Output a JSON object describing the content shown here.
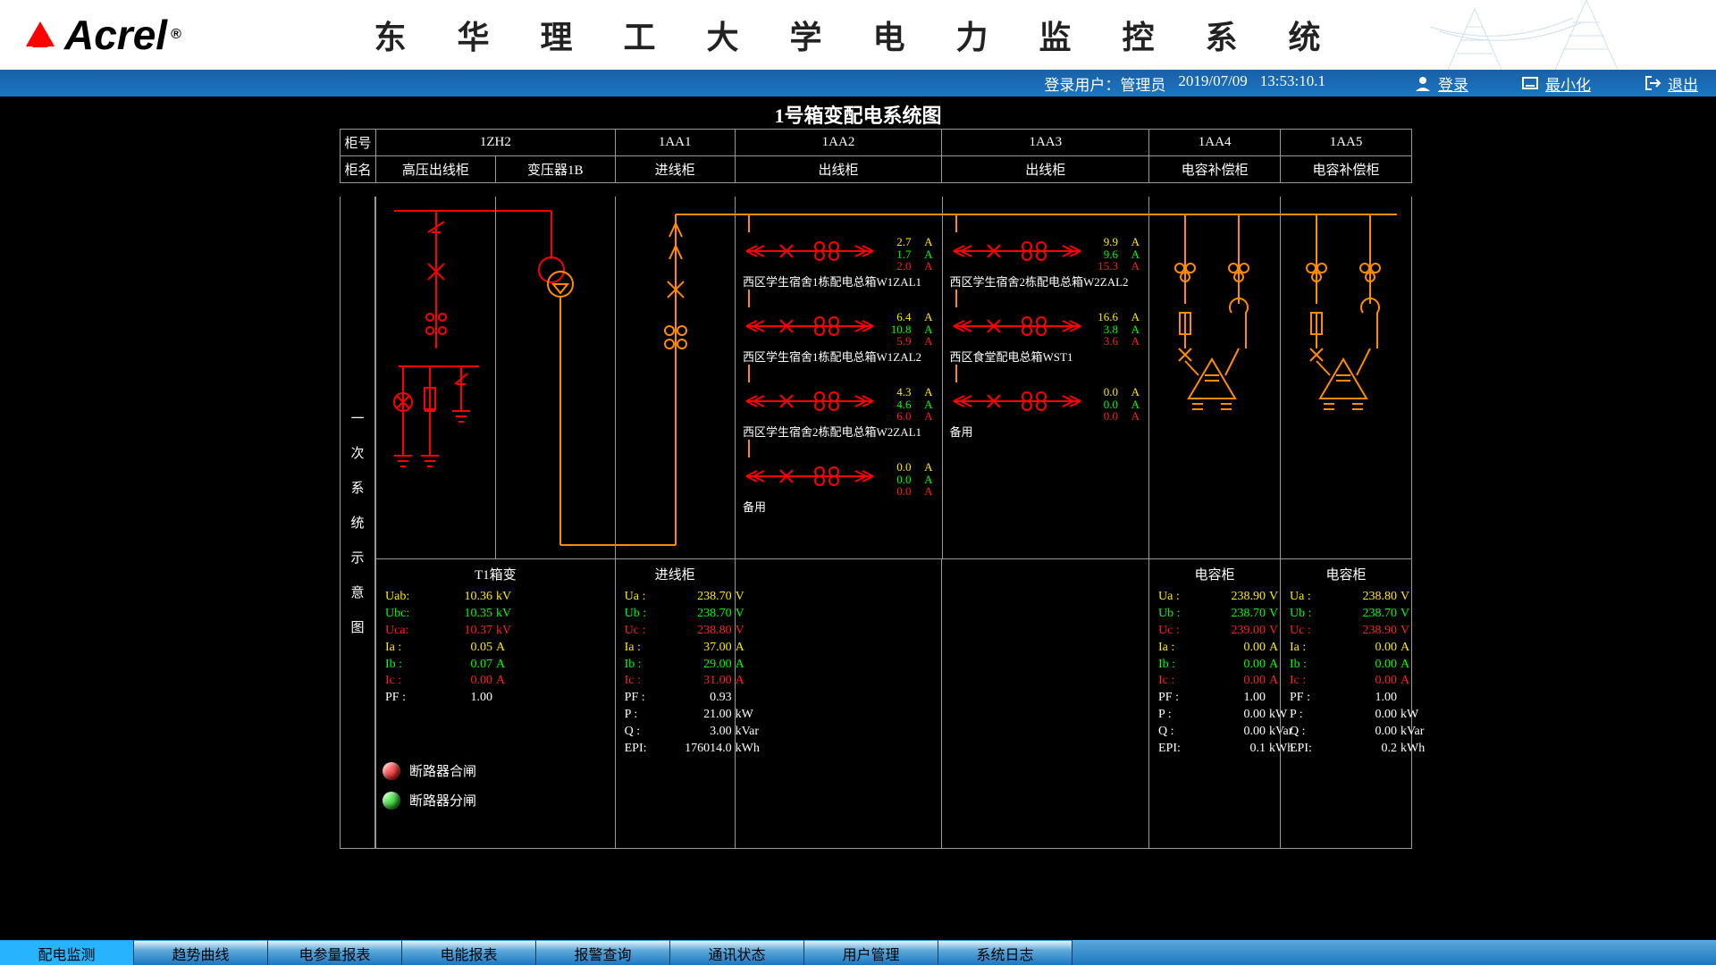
{
  "header": {
    "brand": "Acrel",
    "registered": "®",
    "system_title": "东 华 理 工 大 学 电 力 监 控 系 统"
  },
  "subheader": {
    "user_label": "登录用户：",
    "user": "管理员",
    "date": "2019/07/09",
    "time": "13:53:10.1",
    "login": "登录",
    "minimize": "最小化",
    "exit": "退出"
  },
  "page_title": "1号箱变配电系统图",
  "table": {
    "row1_label": "柜号",
    "row2_label": "柜名",
    "row3_label": "一次系统示意图",
    "cols": [
      {
        "no": "1ZH2",
        "name": "高压出线柜"
      },
      {
        "no": "",
        "name": "变压器1B"
      },
      {
        "no": "1AA1",
        "name": "进线柜"
      },
      {
        "no": "1AA2",
        "name": "出线柜"
      },
      {
        "no": "1AA3",
        "name": "出线柜"
      },
      {
        "no": "1AA4",
        "name": "电容补偿柜"
      },
      {
        "no": "1AA5",
        "name": "电容补偿柜"
      }
    ]
  },
  "feeders_1aa2": [
    {
      "a": "2.7",
      "b": "1.7",
      "c": "2.0",
      "label": "西区学生宿舍1栋配电总箱W1ZAL1"
    },
    {
      "a": "6.4",
      "b": "10.8",
      "c": "5.9",
      "label": "西区学生宿舍1栋配电总箱W1ZAL2"
    },
    {
      "a": "4.3",
      "b": "4.6",
      "c": "6.0",
      "label": "西区学生宿舍2栋配电总箱W2ZAL1"
    },
    {
      "a": "0.0",
      "b": "0.0",
      "c": "0.0",
      "label": "备用"
    }
  ],
  "feeders_1aa3": [
    {
      "a": "9.9",
      "b": "9.6",
      "c": "15.3",
      "label": "西区学生宿舍2栋配电总箱W2ZAL2"
    },
    {
      "a": "16.6",
      "b": "3.8",
      "c": "3.6",
      "label": "西区食堂配电总箱WST1"
    },
    {
      "a": "0.0",
      "b": "0.0",
      "c": "0.0",
      "label": "备用"
    }
  ],
  "data": {
    "t1": {
      "title": "T1箱变",
      "rows": [
        [
          "Uab:",
          "10.36",
          "kV",
          "y"
        ],
        [
          "Ubc:",
          "10.35",
          "kV",
          "g"
        ],
        [
          "Uca:",
          "10.37",
          "kV",
          "r"
        ],
        [
          "Ia :",
          "0.05",
          "A",
          "y"
        ],
        [
          "Ib :",
          "0.07",
          "A",
          "g"
        ],
        [
          "Ic :",
          "0.00",
          "A",
          "r"
        ],
        [
          "PF :",
          "1.00",
          "",
          "w"
        ]
      ]
    },
    "incoming": {
      "title": "进线柜",
      "rows": [
        [
          "Ua :",
          "238.70",
          "V",
          "y"
        ],
        [
          "Ub :",
          "238.70",
          "V",
          "g"
        ],
        [
          "Uc :",
          "238.80",
          "V",
          "r"
        ],
        [
          "Ia :",
          "37.00",
          "A",
          "y"
        ],
        [
          "Ib :",
          "29.00",
          "A",
          "g"
        ],
        [
          "Ic :",
          "31.00",
          "A",
          "r"
        ],
        [
          "PF :",
          "0.93",
          "",
          "w"
        ],
        [
          "P  :",
          "21.00",
          "kW",
          "w"
        ],
        [
          "Q  :",
          "3.00",
          "kVar",
          "w"
        ],
        [
          "EPI:",
          "176014.0",
          "kWh",
          "w"
        ]
      ]
    },
    "cap1": {
      "title": "电容柜",
      "rows": [
        [
          "Ua :",
          "238.90",
          "V",
          "y"
        ],
        [
          "Ub :",
          "238.70",
          "V",
          "g"
        ],
        [
          "Uc :",
          "239.00",
          "V",
          "r"
        ],
        [
          "Ia :",
          "0.00",
          "A",
          "y"
        ],
        [
          "Ib :",
          "0.00",
          "A",
          "g"
        ],
        [
          "Ic :",
          "0.00",
          "A",
          "r"
        ],
        [
          "PF :",
          "1.00",
          "",
          "w"
        ],
        [
          "P  :",
          "0.00",
          "kW",
          "w"
        ],
        [
          "Q  :",
          "0.00",
          "kVar",
          "w"
        ],
        [
          "EPI:",
          "0.1",
          "kWh",
          "w"
        ]
      ]
    },
    "cap2": {
      "title": "电容柜",
      "rows": [
        [
          "Ua :",
          "238.80",
          "V",
          "y"
        ],
        [
          "Ub :",
          "238.70",
          "V",
          "g"
        ],
        [
          "Uc :",
          "238.90",
          "V",
          "r"
        ],
        [
          "Ia :",
          "0.00",
          "A",
          "y"
        ],
        [
          "Ib :",
          "0.00",
          "A",
          "g"
        ],
        [
          "Ic :",
          "0.00",
          "A",
          "r"
        ],
        [
          "PF :",
          "1.00",
          "",
          "w"
        ],
        [
          "P  :",
          "0.00",
          "kW",
          "w"
        ],
        [
          "Q  :",
          "0.00",
          "kVar",
          "w"
        ],
        [
          "EPI:",
          "0.2",
          "kWh",
          "w"
        ]
      ]
    }
  },
  "legend": {
    "closed": "断路器合闸",
    "open": "断路器分闸"
  },
  "tabs": [
    "配电监测",
    "趋势曲线",
    "电参量报表",
    "电能报表",
    "报警查询",
    "通讯状态",
    "用户管理",
    "系统日志"
  ],
  "active_tab": 0
}
